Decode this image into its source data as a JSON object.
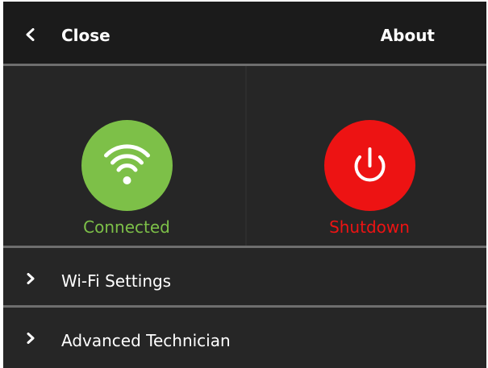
{
  "header": {
    "close_label": "Close",
    "close_icon": "chevron-left-icon",
    "about_label": "About"
  },
  "tiles": {
    "wifi": {
      "label": "Connected",
      "icon": "wifi-icon",
      "color": "#7dc048"
    },
    "power": {
      "label": "Shutdown",
      "icon": "power-icon",
      "color": "#ed1313"
    }
  },
  "menu": {
    "items": [
      {
        "label": "Wi-Fi Settings",
        "icon": "chevron-right-icon"
      },
      {
        "label": "Advanced Technician",
        "icon": "chevron-right-icon"
      }
    ]
  },
  "colors": {
    "background": "#262626",
    "header_background": "#1b1b1b",
    "separator": "#6e6e6e",
    "text": "#ffffff"
  }
}
